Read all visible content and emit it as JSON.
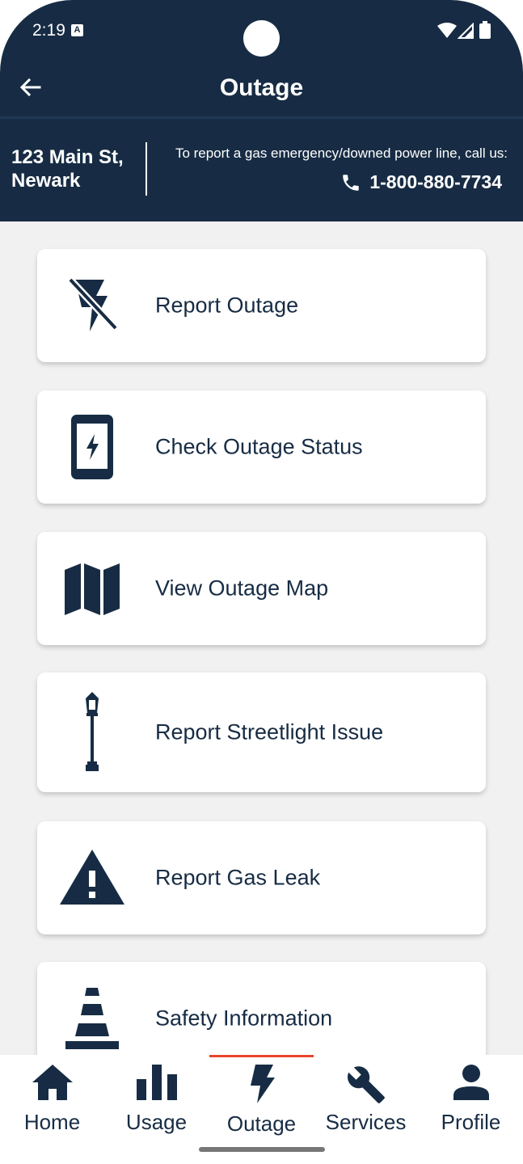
{
  "status_bar": {
    "time": "2:19",
    "notification_badge": "A",
    "icons": [
      "camera-icon",
      "wifi-icon",
      "signal-icon",
      "battery-icon"
    ]
  },
  "header": {
    "title": "Outage",
    "back_icon": "back-arrow-icon",
    "address_line1": "123 Main St,",
    "address_line2": "Newark",
    "emergency_text": "To report a gas emergency/downed power line, call us:",
    "phone_number": "1-800-880-7734",
    "phone_icon": "phone-icon"
  },
  "cards": [
    {
      "label": "Report Outage",
      "icon": "power-off-icon"
    },
    {
      "label": "Check Outage Status",
      "icon": "phone-bolt-icon"
    },
    {
      "label": "View Outage Map",
      "icon": "map-icon"
    },
    {
      "label": "Report Streetlight Issue",
      "icon": "streetlight-icon"
    },
    {
      "label": "Report Gas Leak",
      "icon": "warning-icon"
    },
    {
      "label": "Safety Information",
      "icon": "traffic-cone-icon"
    }
  ],
  "bottom_nav": {
    "active": "Outage",
    "items": [
      {
        "label": "Home",
        "icon": "home-icon"
      },
      {
        "label": "Usage",
        "icon": "bar-chart-icon"
      },
      {
        "label": "Outage",
        "icon": "bolt-icon"
      },
      {
        "label": "Services",
        "icon": "wrench-icon"
      },
      {
        "label": "Profile",
        "icon": "person-icon"
      }
    ]
  },
  "colors": {
    "primary": "#172c44",
    "background": "#f1f1f1",
    "accent": "#e8462c",
    "card": "#ffffff"
  }
}
